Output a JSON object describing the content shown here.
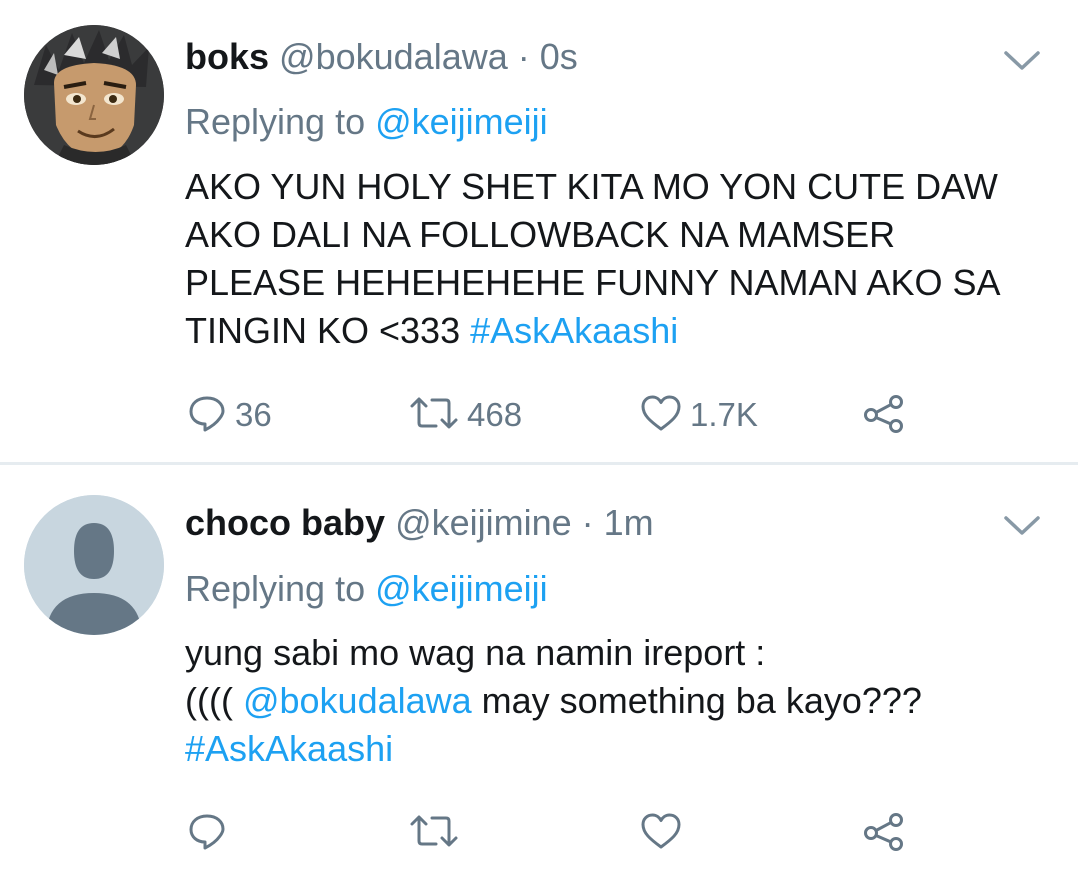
{
  "tweets": [
    {
      "display_name": "boks",
      "handle": "@bokudalawa",
      "separator": " · ",
      "time": "0s",
      "replying_prefix": "Replying to ",
      "replying_to": "@keijimeiji",
      "body_lines": [
        "AKO YUN HOLY SHET KITA MO YON CUTE DAW",
        "AKO DALI NA FOLLOWBACK NA MAMSER",
        "PLEASE HEHEHEHEHE FUNNY NAMAN AKO SA",
        "TINGIN KO <333 "
      ],
      "hashtag": "#AskAkaashi",
      "reply_count": "36",
      "retweet_count": "468",
      "like_count": "1.7K"
    },
    {
      "display_name": "choco baby",
      "handle": "@keijimine",
      "separator": " · ",
      "time": "1m",
      "replying_prefix": "Replying to ",
      "replying_to": "@keijimeiji",
      "body_line1": "yung sabi mo wag na namin ireport :",
      "body_line2_prefix": "(((( ",
      "mention": "@bokudalawa",
      "body_line2_suffix": " may something ba kayo???",
      "hashtag": "#AskAkaashi",
      "reply_count": "",
      "retweet_count": "",
      "like_count": ""
    }
  ],
  "colors": {
    "link": "#1da1f2",
    "secondary_text": "#657786",
    "primary_text": "#14171a",
    "divider": "#e6ecf0",
    "default_avatar_bg": "#c8d6df",
    "default_avatar_fg": "#657786"
  },
  "icons": [
    "reply-icon",
    "retweet-icon",
    "like-icon",
    "share-icon",
    "chevron-down-icon"
  ]
}
